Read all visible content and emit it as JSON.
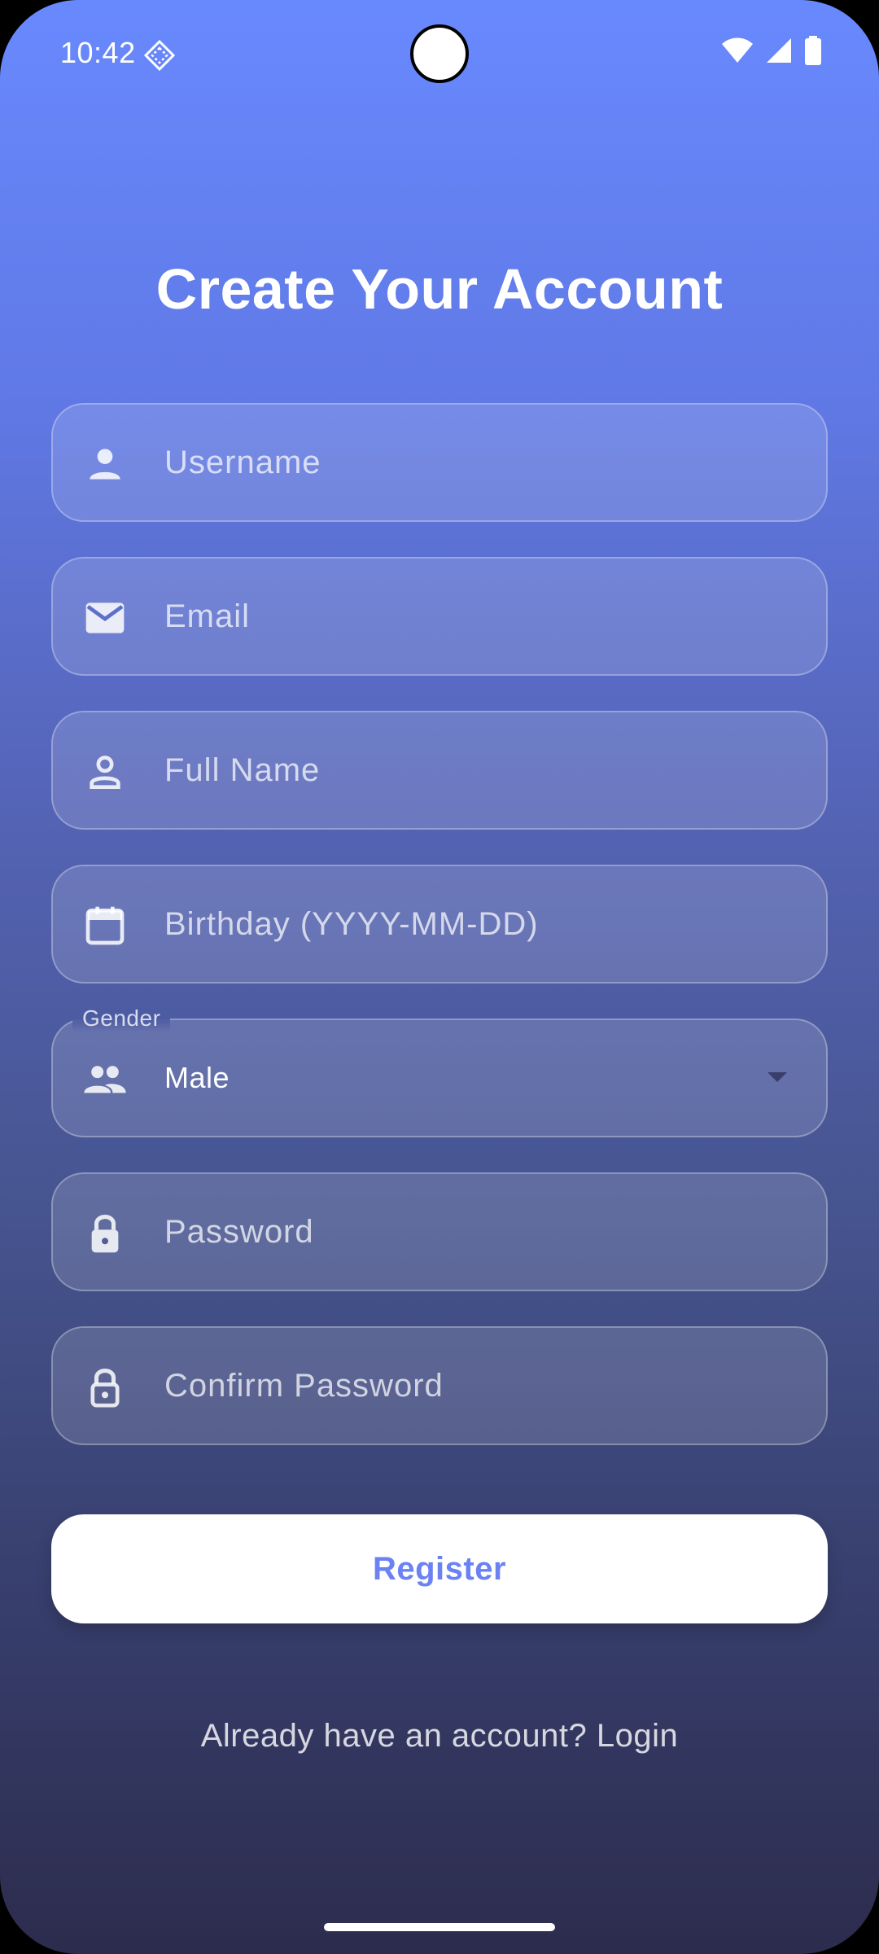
{
  "status_bar": {
    "time": "10:42",
    "app_icon": "notification-diamond-icon",
    "wifi_icon": "wifi-icon",
    "signal_icon": "cell-signal-icon",
    "battery_icon": "battery-icon"
  },
  "screen": {
    "title": "Create Your Account"
  },
  "form": {
    "username": {
      "placeholder": "Username",
      "icon": "person-icon"
    },
    "email": {
      "placeholder": "Email",
      "icon": "mail-icon"
    },
    "full_name": {
      "placeholder": "Full Name",
      "icon": "person-outline-icon"
    },
    "birthday": {
      "placeholder": "Birthday (YYYY-MM-DD)",
      "icon": "calendar-icon"
    },
    "gender": {
      "label": "Gender",
      "value": "Male",
      "icon": "people-icon"
    },
    "password": {
      "placeholder": "Password",
      "icon": "lock-icon"
    },
    "confirm_password": {
      "placeholder": "Confirm Password",
      "icon": "lock-outline-icon"
    }
  },
  "actions": {
    "register_label": "Register",
    "login_prompt": "Already have an account? Login"
  },
  "colors": {
    "gradient_top": "#6889fe",
    "gradient_bottom": "#2c2c4d",
    "accent": "#6a82f3"
  }
}
